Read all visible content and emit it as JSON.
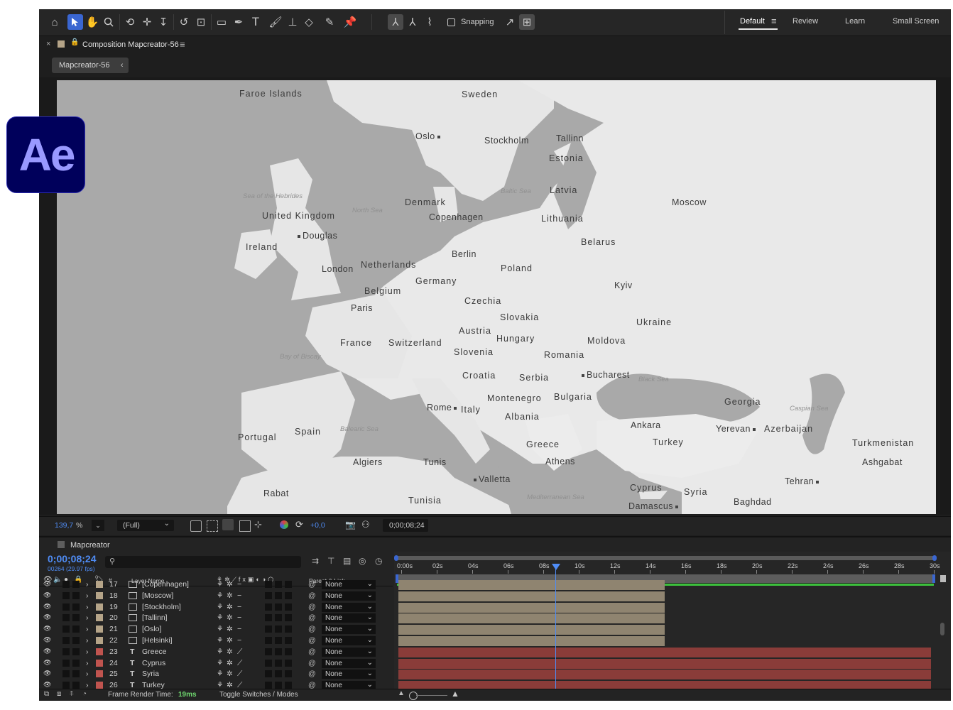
{
  "colors": {
    "accent": "#3a66d1",
    "timecode": "#4f8cf5",
    "map_bg": "#e8e8e8",
    "water": "#a9a9a9",
    "beige_label": "#b5a488",
    "red_label": "#c0544f",
    "bar_beige": "#8f8470",
    "bar_red": "#8a3c39",
    "logo_bg": "#00005b",
    "logo_text": "#9999ff",
    "work_area": "#3cc13c"
  },
  "logo": {
    "text": "Ae"
  },
  "toolbar": {
    "tools": [
      "home-icon",
      "selection-icon",
      "hand-icon",
      "zoom-icon",
      "orbit-icon",
      "track-xy-icon",
      "track-z-icon",
      "rotate-icon",
      "pan-behind-icon",
      "rectangle-icon",
      "pen-icon",
      "text-icon",
      "brush-icon",
      "clone-stamp-icon",
      "eraser-icon",
      "roto-brush-icon",
      "puppet-pin-icon"
    ],
    "snapping_label": "Snapping",
    "workspaces": [
      "Default",
      "Review",
      "Learn",
      "Small Screen"
    ]
  },
  "comp_panel": {
    "title": "Composition Mapcreator-56",
    "breadcrumb": "Mapcreator-56"
  },
  "map": {
    "countries": [
      {
        "name": "Faroe Islands"
      },
      {
        "name": "Sweden"
      },
      {
        "name": "Estonia"
      },
      {
        "name": "Latvia"
      },
      {
        "name": "Denmark"
      },
      {
        "name": "Lithuania"
      },
      {
        "name": "United Kingdom"
      },
      {
        "name": "Ireland"
      },
      {
        "name": "Belarus"
      },
      {
        "name": "Netherlands"
      },
      {
        "name": "Poland"
      },
      {
        "name": "Germany"
      },
      {
        "name": "Belgium"
      },
      {
        "name": "Czechia"
      },
      {
        "name": "Slovakia"
      },
      {
        "name": "Ukraine"
      },
      {
        "name": "Austria"
      },
      {
        "name": "Hungary"
      },
      {
        "name": "France"
      },
      {
        "name": "Switzerland"
      },
      {
        "name": "Moldova"
      },
      {
        "name": "Slovenia"
      },
      {
        "name": "Romania"
      },
      {
        "name": "Croatia"
      },
      {
        "name": "Serbia"
      },
      {
        "name": "Montenegro"
      },
      {
        "name": "Bulgaria"
      },
      {
        "name": "Georgia"
      },
      {
        "name": "Italy"
      },
      {
        "name": "Albania"
      },
      {
        "name": "Azerbaijan"
      },
      {
        "name": "Portugal"
      },
      {
        "name": "Spain"
      },
      {
        "name": "Turkey"
      },
      {
        "name": "Greece"
      },
      {
        "name": "Turkmenistan"
      },
      {
        "name": "Tunisia"
      },
      {
        "name": "Cyprus"
      },
      {
        "name": "Syria"
      }
    ],
    "cities": [
      {
        "name": "Oslo"
      },
      {
        "name": "Stockholm"
      },
      {
        "name": "Tallinn"
      },
      {
        "name": "Copenhagen"
      },
      {
        "name": "Moscow"
      },
      {
        "name": "Douglas"
      },
      {
        "name": "Berlin"
      },
      {
        "name": "London"
      },
      {
        "name": "Kyiv"
      },
      {
        "name": "Paris"
      },
      {
        "name": "Bucharest"
      },
      {
        "name": "Rome"
      },
      {
        "name": "Ankara"
      },
      {
        "name": "Yerevan"
      },
      {
        "name": "Ashgabat"
      },
      {
        "name": "Algiers"
      },
      {
        "name": "Tunis"
      },
      {
        "name": "Athens"
      },
      {
        "name": "Valletta"
      },
      {
        "name": "Tehran"
      },
      {
        "name": "Rabat"
      },
      {
        "name": "Baghdad"
      },
      {
        "name": "Damascus"
      }
    ],
    "seas": [
      {
        "name": "Sea of the Hebrides"
      },
      {
        "name": "North Sea"
      },
      {
        "name": "Baltic Sea"
      },
      {
        "name": "Bay of Biscay"
      },
      {
        "name": "Black Sea"
      },
      {
        "name": "Balearic Sea"
      },
      {
        "name": "Caspian Sea"
      },
      {
        "name": "Mediterranean Sea"
      }
    ]
  },
  "viewer_footer": {
    "zoom": "139,7",
    "zoom_unit": "%",
    "resolution": "(Full)",
    "exposure": "+0,0",
    "timecode": "0;00;08;24"
  },
  "timeline": {
    "panel_title": "Mapcreator",
    "current_time": "0;00;08;24",
    "frame_info": "00264 (29.97 fps)",
    "search_placeholder": "",
    "col_number": "#",
    "col_layer_name": "Layer Name",
    "col_parent": "Parent & Link",
    "ruler": [
      "0:00s",
      "02s",
      "04s",
      "06s",
      "08s",
      "10s",
      "12s",
      "14s",
      "16s",
      "18s",
      "20s",
      "22s",
      "24s",
      "26s",
      "28s",
      "30s"
    ],
    "layers": [
      {
        "num": "17",
        "name": "[Copenhagen]",
        "type": "comp",
        "parent": "None",
        "color": "beige"
      },
      {
        "num": "18",
        "name": "[Moscow]",
        "type": "comp",
        "parent": "None",
        "color": "beige"
      },
      {
        "num": "19",
        "name": "[Stockholm]",
        "type": "comp",
        "parent": "None",
        "color": "beige"
      },
      {
        "num": "20",
        "name": "[Tallinn]",
        "type": "comp",
        "parent": "None",
        "color": "beige"
      },
      {
        "num": "21",
        "name": "[Oslo]",
        "type": "comp",
        "parent": "None",
        "color": "beige"
      },
      {
        "num": "22",
        "name": "[Helsinki]",
        "type": "comp",
        "parent": "None",
        "color": "beige"
      },
      {
        "num": "23",
        "name": "Greece",
        "type": "text",
        "parent": "None",
        "color": "red"
      },
      {
        "num": "24",
        "name": "Cyprus",
        "type": "text",
        "parent": "None",
        "color": "red"
      },
      {
        "num": "25",
        "name": "Syria",
        "type": "text",
        "parent": "None",
        "color": "red"
      },
      {
        "num": "26",
        "name": "Turkey",
        "type": "text",
        "parent": "None",
        "color": "red"
      }
    ],
    "footer": {
      "render_time_label": "Frame Render Time:",
      "render_time_value": "19ms",
      "toggle_label": "Toggle Switches / Modes"
    }
  }
}
